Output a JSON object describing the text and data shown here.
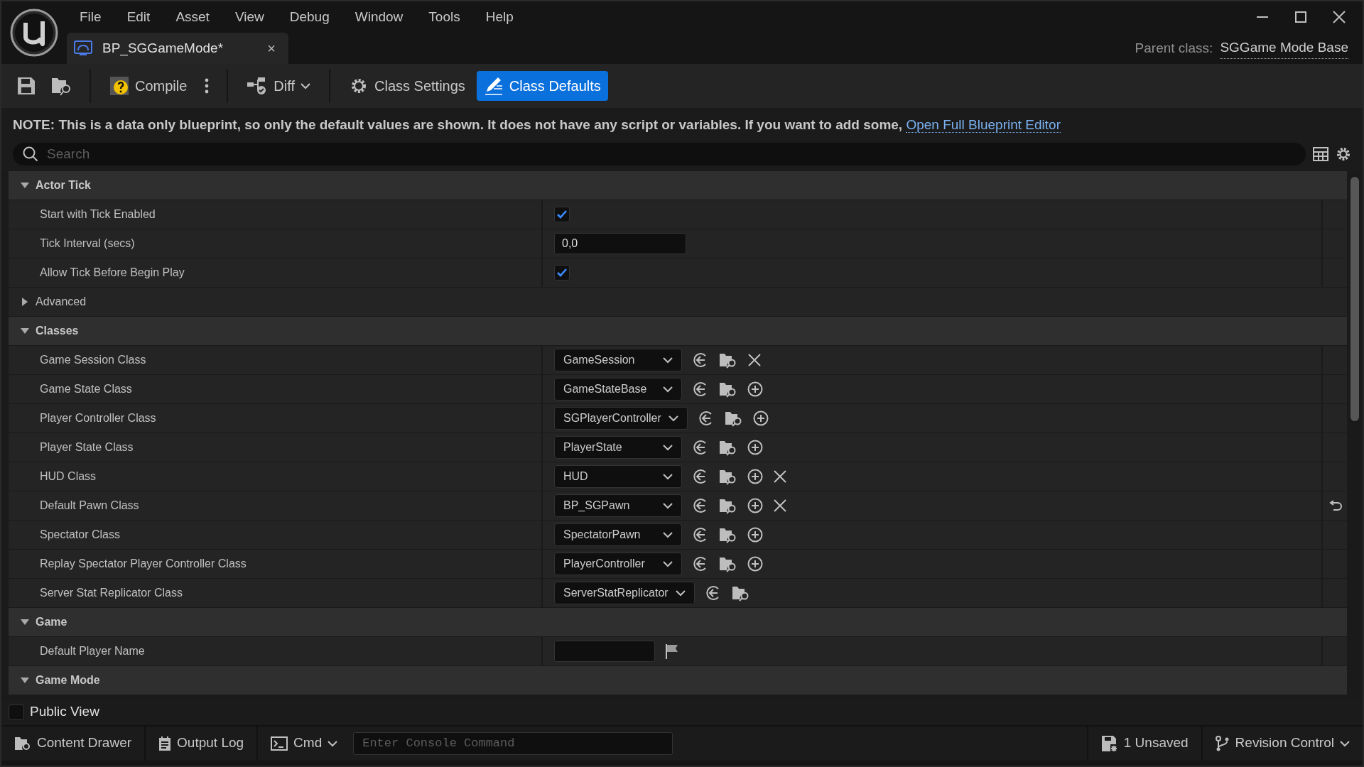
{
  "menu": [
    "File",
    "Edit",
    "Asset",
    "View",
    "Debug",
    "Window",
    "Tools",
    "Help"
  ],
  "tab": {
    "title": "BP_SGGameMode*",
    "close": "×"
  },
  "parent_class": {
    "label": "Parent class:",
    "value": "SGGame Mode Base"
  },
  "toolbar": [
    {
      "kind": "save"
    },
    {
      "kind": "browse"
    },
    {
      "kind": "compile",
      "label": "Compile"
    },
    {
      "kind": "more"
    },
    {
      "kind": "diff",
      "label": "Diff"
    }
  ],
  "modes": [
    {
      "kind": "settings",
      "label": "Class Settings",
      "selected": false
    },
    {
      "kind": "defaults",
      "label": "Class Defaults",
      "selected": true
    }
  ],
  "note": {
    "text": "NOTE: This is a data only blueprint, so only the default values are shown.  It does not have any script or variables.  If you want to add some,",
    "link": "Open Full Blueprint Editor"
  },
  "search": {
    "placeholder": "Search"
  },
  "sections": [
    {
      "title": "Actor Tick",
      "expanded": true,
      "rows": [
        {
          "kind": "checkbox",
          "label": "Start with Tick Enabled",
          "checked": true
        },
        {
          "kind": "number",
          "label": "Tick Interval (secs)",
          "value": "0,0"
        },
        {
          "kind": "checkbox",
          "label": "Allow Tick Before Begin Play",
          "checked": true
        },
        {
          "kind": "group",
          "label": "Advanced",
          "expanded": false
        }
      ]
    },
    {
      "title": "Classes",
      "expanded": true,
      "rows": [
        {
          "kind": "class",
          "label": "Game Session Class",
          "value": "GameSession",
          "actions": [
            {
              "kind": "use"
            },
            {
              "kind": "browse"
            },
            {
              "kind": "clear"
            }
          ],
          "modified": false
        },
        {
          "kind": "class",
          "label": "Game State Class",
          "value": "GameStateBase",
          "actions": [
            {
              "kind": "use"
            },
            {
              "kind": "browse"
            },
            {
              "kind": "add"
            }
          ],
          "modified": false
        },
        {
          "kind": "class",
          "label": "Player Controller Class",
          "value": "SGPlayerController",
          "actions": [
            {
              "kind": "use"
            },
            {
              "kind": "browse"
            },
            {
              "kind": "add"
            }
          ],
          "modified": false
        },
        {
          "kind": "class",
          "label": "Player State Class",
          "value": "PlayerState",
          "actions": [
            {
              "kind": "use"
            },
            {
              "kind": "browse"
            },
            {
              "kind": "add"
            }
          ],
          "modified": false
        },
        {
          "kind": "class",
          "label": "HUD Class",
          "value": "HUD",
          "actions": [
            {
              "kind": "use"
            },
            {
              "kind": "browse"
            },
            {
              "kind": "add"
            },
            {
              "kind": "clear"
            }
          ],
          "modified": false
        },
        {
          "kind": "class",
          "label": "Default Pawn Class",
          "value": "BP_SGPawn",
          "actions": [
            {
              "kind": "use"
            },
            {
              "kind": "browse"
            },
            {
              "kind": "add"
            },
            {
              "kind": "clear"
            }
          ],
          "modified": true
        },
        {
          "kind": "class",
          "label": "Spectator Class",
          "value": "SpectatorPawn",
          "actions": [
            {
              "kind": "use"
            },
            {
              "kind": "browse"
            },
            {
              "kind": "add"
            }
          ],
          "modified": false
        },
        {
          "kind": "class",
          "label": "Replay Spectator Player Controller Class",
          "value": "PlayerController",
          "actions": [
            {
              "kind": "use"
            },
            {
              "kind": "browse"
            },
            {
              "kind": "add"
            }
          ],
          "modified": false
        },
        {
          "kind": "class",
          "label": "Server Stat Replicator Class",
          "value": "ServerStatReplicator",
          "actions": [
            {
              "kind": "use"
            },
            {
              "kind": "browse"
            }
          ],
          "modified": false
        }
      ]
    },
    {
      "title": "Game",
      "expanded": true,
      "rows": [
        {
          "kind": "text",
          "label": "Default Player Name",
          "actions": [
            {
              "kind": "flag"
            }
          ]
        }
      ]
    },
    {
      "title": "Game Mode",
      "expanded": true
    }
  ],
  "public_view": {
    "label": "Public View",
    "checked": false
  },
  "status_bar": {
    "left": [
      {
        "kind": "drawer",
        "label": "Content Drawer"
      },
      {
        "kind": "log",
        "label": "Output Log"
      },
      {
        "kind": "cmd",
        "label": "Cmd"
      }
    ],
    "console": {
      "placeholder": "Enter Console Command"
    },
    "right": [
      {
        "kind": "unsaved",
        "label": "1 Unsaved"
      },
      {
        "kind": "revision",
        "label": "Revision Control"
      }
    ]
  }
}
